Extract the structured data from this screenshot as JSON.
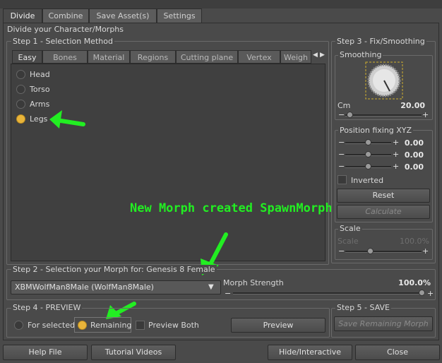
{
  "tabs": [
    "Divide",
    "Combine",
    "Save Asset(s)",
    "Settings"
  ],
  "title": "Divide your Character/Morphs",
  "step1": {
    "label": "Step 1 - Selection Method",
    "subtabs": [
      "Easy",
      "Bones",
      "Material",
      "Regions",
      "Cutting plane",
      "Vertex",
      "Weigh"
    ],
    "options": [
      "Head",
      "Torso",
      "Arms",
      "Legs"
    ],
    "selected": "Legs"
  },
  "annotation": {
    "text": "New Morph created SpawnMorph",
    "color": "#22ee22"
  },
  "step2": {
    "label": "Step 2 - Selection your Morph for: Genesis 8 Female",
    "morph_value": "XBMWolfMan8Male (WolfMan8Male)",
    "strength_label": "Morph Strength",
    "strength_value": "100.0%",
    "strength_fraction": 1.0
  },
  "step3": {
    "label": "Step 3 - Fix/Smoothing",
    "smoothing_label": "Smoothing",
    "cm_label": "Cm",
    "cm_value": "20.00",
    "position_label": "Position fixing XYZ",
    "xyz_values": [
      "0.00",
      "0.00",
      "0.00"
    ],
    "inverted_label": "Inverted",
    "reset_label": "Reset",
    "calculate_label": "Calculate",
    "scale_label": "Scale",
    "scale_field": "Scale",
    "scale_value": "100.0%"
  },
  "step4": {
    "label": "Step 4 - PREVIEW",
    "for_selected": "For selected",
    "remaining": "Remaining",
    "preview_both": "Preview Both",
    "preview_button": "Preview"
  },
  "step5": {
    "label": "Step 5 - SAVE",
    "save_button": "Save Remaining Morph"
  },
  "footer": {
    "help": "Help File",
    "tutorial": "Tutorial Videos",
    "hide": "Hide/Interactive",
    "close": "Close"
  }
}
